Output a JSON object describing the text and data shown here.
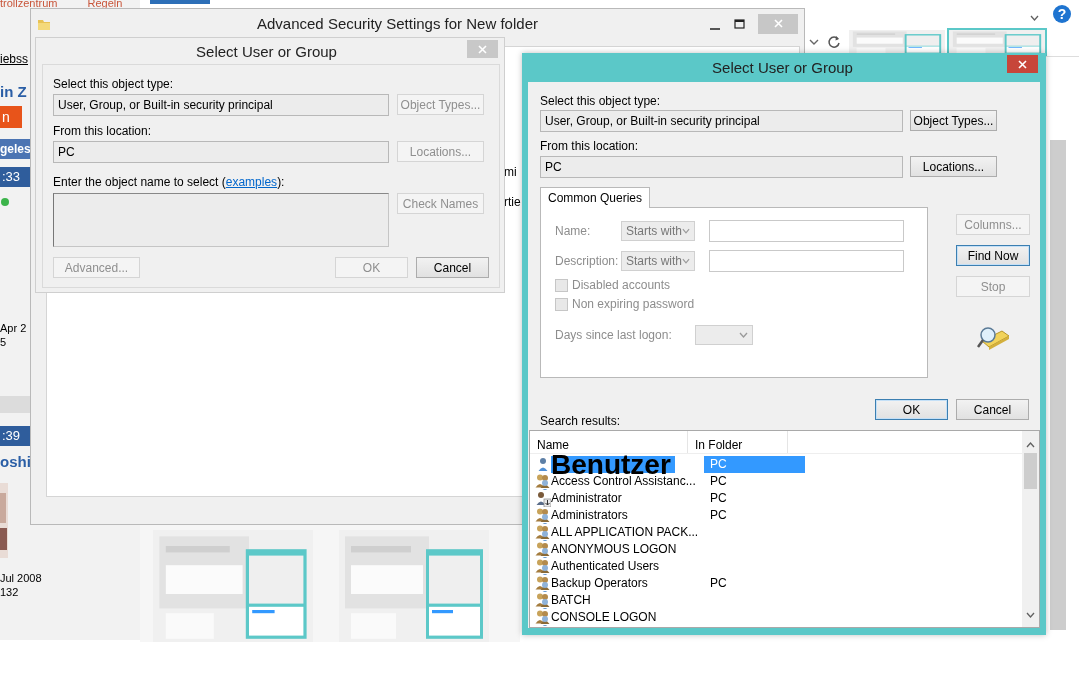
{
  "browser": {
    "tabs": [
      "trollzentrum",
      "Regeln"
    ],
    "help_glyph": "?"
  },
  "background_page": {
    "fragments": [
      {
        "kind": "link",
        "text": "iebss"
      },
      {
        "kind": "heading",
        "text": "in Z"
      },
      {
        "kind": "orange_button",
        "text": "n"
      },
      {
        "kind": "bar",
        "text": "geles"
      },
      {
        "kind": "dark_bar",
        "text": ":33"
      },
      {
        "kind": "dot",
        "color": "#3cb44b"
      },
      {
        "kind": "plain",
        "text": "Apr 2"
      },
      {
        "kind": "plain",
        "text": "5"
      },
      {
        "kind": "band"
      },
      {
        "kind": "dark_bar",
        "text": ":39"
      },
      {
        "kind": "heading",
        "text": "oshi"
      },
      {
        "kind": "picture"
      },
      {
        "kind": "plain",
        "text": "Jul 2008"
      },
      {
        "kind": "plain",
        "text": "132"
      }
    ],
    "side_texts": [
      "mi",
      "rtie"
    ]
  },
  "advanced_window": {
    "title": "Advanced Security Settings for New folder"
  },
  "back_dialog": {
    "title": "Select User or Group",
    "object_type_label": "Select this object type:",
    "object_type": "User, Group, or Built-in security principal",
    "location_label": "From this location:",
    "location": "PC",
    "name_label": "Enter the object name to select (",
    "name_link": "examples",
    "name_label_end": "):",
    "buttons": [
      {
        "label": "Object Types...",
        "disabled": true
      },
      {
        "label": "Locations...",
        "disabled": true
      },
      {
        "label": "Check Names",
        "disabled": true
      },
      {
        "label": "Advanced...",
        "disabled": true
      },
      {
        "label": "OK",
        "disabled": true
      },
      {
        "label": "Cancel",
        "disabled": false
      }
    ]
  },
  "front_dialog": {
    "title": "Select User or Group",
    "object_type_label": "Select this object type:",
    "object_type": "User, Group, or Built-in security principal",
    "location_label": "From this location:",
    "location": "PC",
    "object_types_button": {
      "label": "Object Types...",
      "disabled": false
    },
    "locations_button": {
      "label": "Locations...",
      "disabled": false
    },
    "tab": {
      "label": "Common Queries",
      "selected": true
    },
    "queries": {
      "disabled": true,
      "name_label": "Name:",
      "name_mode": "Starts with",
      "description_label": "Description:",
      "description_mode": "Starts with",
      "checkboxes": [
        {
          "label": "Disabled accounts",
          "checked": false
        },
        {
          "label": "Non expiring password",
          "checked": false
        }
      ],
      "days_label": "Days since last logon:"
    },
    "side_buttons": [
      {
        "label": "Columns...",
        "disabled": true,
        "default": false
      },
      {
        "label": "Find Now",
        "disabled": false,
        "default": true
      },
      {
        "label": "Stop",
        "disabled": true,
        "default": false
      }
    ],
    "ok_button": {
      "label": "OK",
      "default": true
    },
    "cancel_button": {
      "label": "Cancel",
      "default": false
    },
    "results_label": "Search results:",
    "columns": [
      "Name",
      "In Folder"
    ],
    "rows": [
      {
        "kind": "user",
        "name": "Benutzer",
        "folder": "PC",
        "selected": true,
        "big": true
      },
      {
        "kind": "group",
        "name": "Access Control Assistanc...",
        "folder": "PC",
        "selected": false
      },
      {
        "kind": "admin",
        "name": "Administrator",
        "folder": "PC",
        "selected": false
      },
      {
        "kind": "group",
        "name": "Administrators",
        "folder": "PC",
        "selected": false
      },
      {
        "kind": "group",
        "name": "ALL APPLICATION PACK...",
        "selected": false
      },
      {
        "kind": "group",
        "name": "ANONYMOUS LOGON",
        "selected": false
      },
      {
        "kind": "group",
        "name": "Authenticated Users",
        "selected": false
      },
      {
        "kind": "group",
        "name": "Backup Operators",
        "folder": "PC",
        "selected": false
      },
      {
        "kind": "group",
        "name": "BATCH",
        "selected": false
      },
      {
        "kind": "group",
        "name": "CONSOLE LOGON",
        "selected": false
      }
    ]
  }
}
